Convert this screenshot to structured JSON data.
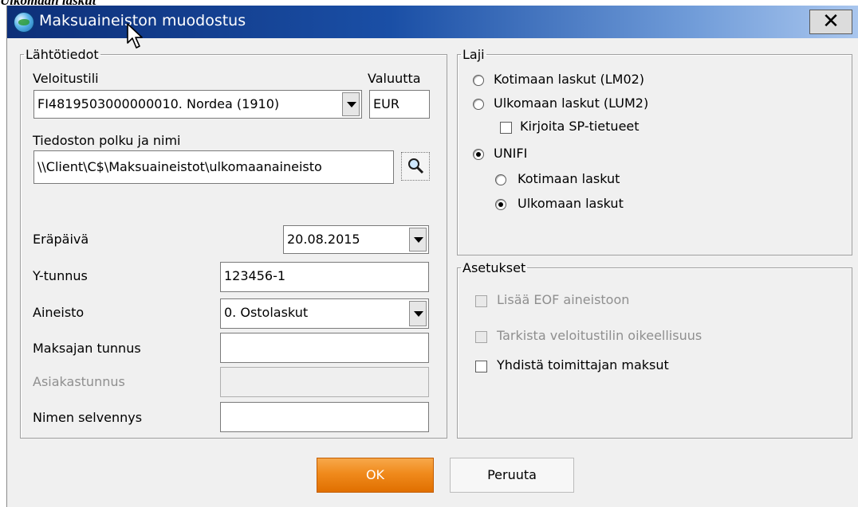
{
  "page_caption": "Ulkomaan laskut",
  "window": {
    "title": "Maksuaineiston muodostus",
    "close_label": "✕"
  },
  "lahtotiedot": {
    "legend": "Lähtötiedot",
    "veloitustili_label": "Veloitustili",
    "valuutta_label": "Valuutta",
    "veloitustili_value": "FI4819503000000010. Nordea (1910)",
    "valuutta_value": "EUR",
    "path_label": "Tiedoston polku ja nimi",
    "path_value": "\\\\Client\\C$\\Maksuaineistot\\ulkomaanaineisto",
    "erapaiva_label": "Eräpäivä",
    "erapaiva_value": "20.08.2015",
    "ytunnus_label": "Y-tunnus",
    "ytunnus_value": "123456-1",
    "aineisto_label": "Aineisto",
    "aineisto_value": "0. Ostolaskut",
    "maksajan_label": "Maksajan tunnus",
    "maksajan_value": "",
    "asiakastunnus_label": "Asiakastunnus",
    "asiakastunnus_value": "",
    "nimen_label": "Nimen selvennys",
    "nimen_value": ""
  },
  "laji": {
    "legend": "Laji",
    "kotimaan_lm02": "Kotimaan laskut (LM02)",
    "ulkomaan_lum2": "Ulkomaan laskut (LUM2)",
    "kirjoita_sp": "Kirjoita SP-tietueet",
    "unifi": "UNIFI",
    "unifi_kotimaan": "Kotimaan laskut",
    "unifi_ulkomaan": "Ulkomaan laskut"
  },
  "asetukset": {
    "legend": "Asetukset",
    "lisaa_eof": "Lisää EOF aineistoon",
    "tarkista": "Tarkista veloitustilin oikeellisuus",
    "yhdista": "Yhdistä toimittajan maksut"
  },
  "buttons": {
    "ok": "OK",
    "cancel": "Peruuta"
  },
  "colors": {
    "titlebar": "#1a4fa6",
    "ok_button": "#f08a1c"
  }
}
